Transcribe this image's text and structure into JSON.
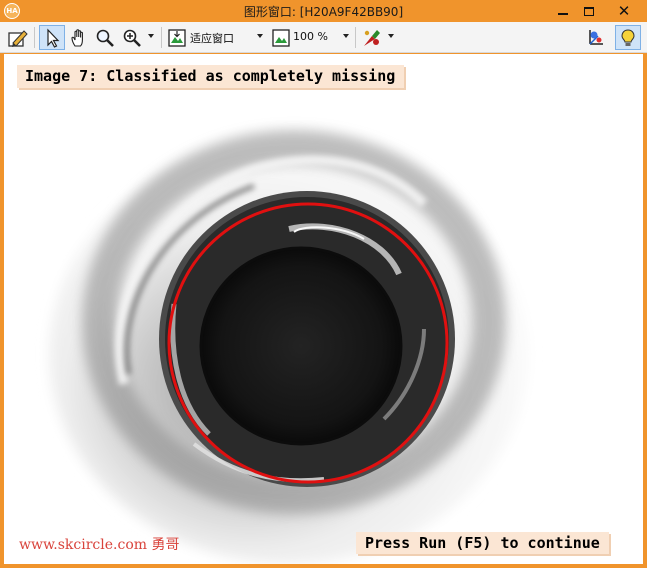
{
  "window": {
    "app_icon_text": "HA",
    "title": "图形窗口: [H20A9F42BB90]",
    "minimize_label": "",
    "maximize_label": "",
    "close_label": "✕"
  },
  "toolbar": {
    "fit_mode": "适应窗口",
    "zoom": "100 %"
  },
  "canvas": {
    "message_top": "Image 7: Classified as completely missing",
    "message_bottom": "Press Run (F5) to continue",
    "watermark": "www.skcircle.com 勇哥"
  },
  "colors": {
    "title_bar": "#f0942c",
    "message_bg": "#fbe6d4",
    "circle": "#e01010",
    "watermark": "#d9433b"
  }
}
